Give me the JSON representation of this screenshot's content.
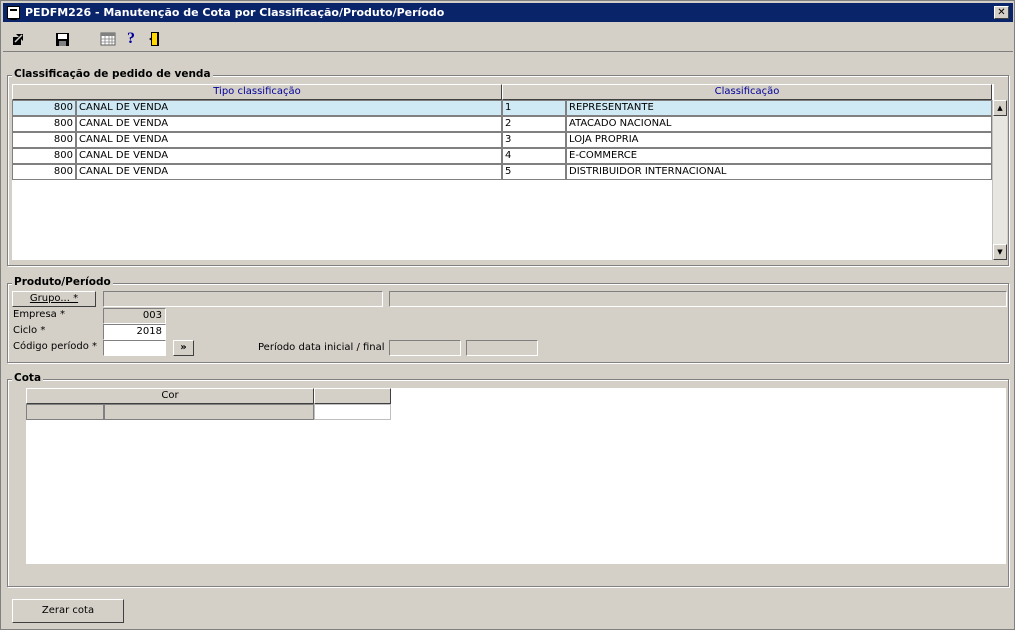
{
  "window": {
    "title": "PEDFM226 - Manutenção de Cota por Classificação/Produto/Período",
    "close_label": "✕"
  },
  "toolbar": {
    "help_label": "?"
  },
  "classificacao": {
    "legend": "Classificação de pedido de venda",
    "col_tipo": "Tipo classificação",
    "col_classificacao": "Classificação",
    "rows": [
      {
        "tipo_cod": "800",
        "tipo_desc": "CANAL DE VENDA",
        "class_cod": "1",
        "class_desc": "REPRESENTANTE"
      },
      {
        "tipo_cod": "800",
        "tipo_desc": "CANAL DE VENDA",
        "class_cod": "2",
        "class_desc": "ATACADO NACIONAL"
      },
      {
        "tipo_cod": "800",
        "tipo_desc": "CANAL DE VENDA",
        "class_cod": "3",
        "class_desc": "LOJA PROPRIA"
      },
      {
        "tipo_cod": "800",
        "tipo_desc": "CANAL DE VENDA",
        "class_cod": "4",
        "class_desc": "E-COMMERCE"
      },
      {
        "tipo_cod": "800",
        "tipo_desc": "CANAL DE VENDA",
        "class_cod": "5",
        "class_desc": "DISTRIBUIDOR INTERNACIONAL"
      }
    ]
  },
  "produto": {
    "legend": "Produto/Período",
    "grupo_button": "Grupo... *",
    "empresa_label": "Empresa *",
    "empresa_value": "003",
    "ciclo_label": "Ciclo *",
    "ciclo_value": "2018",
    "codigo_label": "Código período *",
    "codigo_value": "",
    "go_button": "»",
    "periodo_label": "Período data inicial / final"
  },
  "cota": {
    "legend": "Cota",
    "col_cor": "Cor"
  },
  "footer": {
    "zerar_button": "Zerar cota"
  }
}
